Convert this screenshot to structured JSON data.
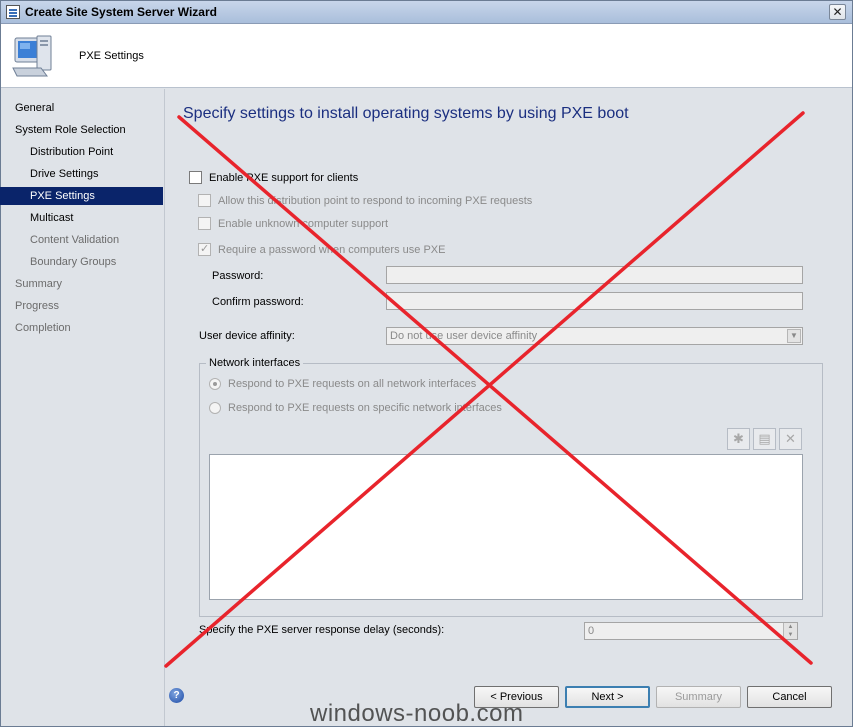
{
  "window": {
    "title": "Create Site System Server Wizard",
    "close_glyph": "✕"
  },
  "header": {
    "title": "PXE Settings"
  },
  "nav": [
    {
      "label": "General",
      "level": 0,
      "state": "normal"
    },
    {
      "label": "System Role Selection",
      "level": 0,
      "state": "normal"
    },
    {
      "label": "Distribution Point",
      "level": 1,
      "state": "normal"
    },
    {
      "label": "Drive Settings",
      "level": 1,
      "state": "normal"
    },
    {
      "label": "PXE Settings",
      "level": 1,
      "state": "active"
    },
    {
      "label": "Multicast",
      "level": 1,
      "state": "normal"
    },
    {
      "label": "Content Validation",
      "level": 1,
      "state": "dim"
    },
    {
      "label": "Boundary Groups",
      "level": 1,
      "state": "dim"
    },
    {
      "label": "Summary",
      "level": 0,
      "state": "dim"
    },
    {
      "label": "Progress",
      "level": 0,
      "state": "dim"
    },
    {
      "label": "Completion",
      "level": 0,
      "state": "dim"
    }
  ],
  "main": {
    "heading": "Specify settings to install operating systems by using PXE boot",
    "enable_pxe": {
      "label": "Enable PXE support for clients",
      "checked": false
    },
    "allow_respond": {
      "label": "Allow this distribution point to respond to incoming PXE requests",
      "checked": false
    },
    "unknown_support": {
      "label": "Enable unknown computer support",
      "checked": false
    },
    "require_password": {
      "label": "Require a password when computers use PXE",
      "checked": true
    },
    "password_label": "Password:",
    "password_value": "",
    "confirm_label": "Confirm password:",
    "confirm_value": "",
    "affinity_label": "User device affinity:",
    "affinity_value": "Do not use user device affinity",
    "network": {
      "legend": "Network interfaces",
      "all_label": "Respond to PXE requests on all network interfaces",
      "specific_label": "Respond to PXE requests on specific network interfaces",
      "tool_icons": [
        "star-icon",
        "properties-icon",
        "delete-icon"
      ]
    },
    "delay_label": "Specify the PXE server response delay (seconds):",
    "delay_value": "0"
  },
  "footer": {
    "help_glyph": "?",
    "previous": "< Previous",
    "next": "Next >",
    "summary": "Summary",
    "cancel": "Cancel"
  },
  "watermark": "windows-noob.com",
  "colors": {
    "accent_nav": "#0a246a",
    "heading": "#1b2f80",
    "cross": "#e8242c"
  }
}
